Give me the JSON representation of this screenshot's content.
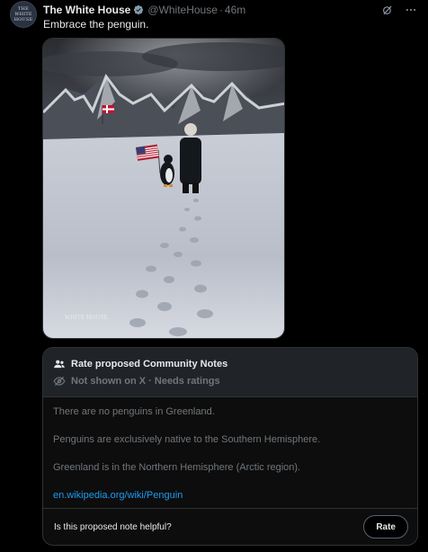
{
  "tweet": {
    "avatar_text": "THE WHITE HOUSE",
    "author_name": "The White House",
    "handle": "@WhiteHouse",
    "separator": "·",
    "time": "46m",
    "text": "Embrace the penguin.",
    "icons": {
      "verified": "verified-badge-icon",
      "grok": "grok-icon",
      "more": "more-icon"
    },
    "media": {
      "watermark": "WHITE HOUSE"
    }
  },
  "community_notes": {
    "title": "Rate proposed Community Notes",
    "status": "Not shown on X · Needs ratings",
    "lines": [
      "There are no penguins in Greenland.",
      "Penguins are exclusively native to the Southern Hemisphere.",
      "Greenland is in the Northern Hemisphere (Arctic region)."
    ],
    "link": "en.wikipedia.org/wiki/Penguin",
    "question": "Is this proposed note helpful?",
    "rate_label": "Rate",
    "icons": {
      "people": "people-icon",
      "hidden": "eye-off-icon"
    }
  },
  "colors": {
    "background": "#000000",
    "text": "#e7e9ea",
    "muted": "#71767b",
    "link": "#1d9bf0",
    "border": "#2f3336",
    "verified": "#829aab"
  }
}
